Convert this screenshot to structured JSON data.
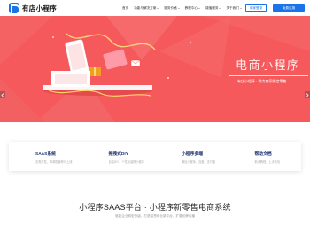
{
  "brand": {
    "name": "有店小程序",
    "color": "#1a73e8"
  },
  "nav": {
    "items": [
      {
        "label": "首页",
        "has_dropdown": false
      },
      {
        "label": "功能与解决方案",
        "has_dropdown": true
      },
      {
        "label": "服务价格",
        "has_dropdown": true
      },
      {
        "label": "教程中心",
        "has_dropdown": true
      },
      {
        "label": "增值服务",
        "has_dropdown": true
      },
      {
        "label": "关于我们",
        "has_dropdown": true
      }
    ],
    "login_label": "商家登录",
    "trial_label": "免费试用"
  },
  "hero": {
    "title": "电商小程序",
    "subtitle": "有店小程序 · 助力商家微信零售",
    "background": "#f5595b"
  },
  "features": [
    {
      "title": "SAAS系统",
      "desc": "无需开发，简单配置即可上线"
    },
    {
      "title": "拖拽式DIY",
      "desc": "自由DIY，个性化装修小程序"
    },
    {
      "title": "小程序多端",
      "desc": "微信小程序、百度、支付宝"
    },
    {
      "title": "帮助文档",
      "desc": "新手教程，上手无忧"
    }
  ],
  "intro": {
    "title": "小程序SAAS平台 · 小程序新零售电商系统",
    "subtitle": "赋能企业转型升级，打造智慧商业新平台，扩展品牌传播"
  }
}
